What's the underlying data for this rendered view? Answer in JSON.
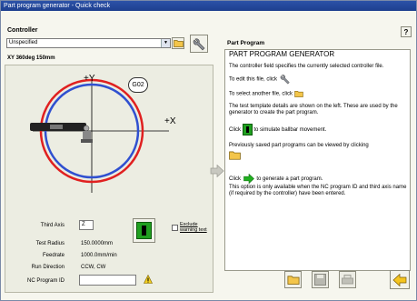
{
  "window": {
    "title": "Part program generator - Quick check"
  },
  "controller": {
    "heading": "Controller",
    "selected": "Unspecified"
  },
  "plot": {
    "heading": "XY 360deg 150mm",
    "plus_y": "+Y",
    "plus_x": "+X",
    "g02": "G02"
  },
  "settings": {
    "third_axis_label": "Third Axis",
    "third_axis_value": "Z",
    "test_radius_label": "Test Radius",
    "test_radius_value": "150.0000mm",
    "feedrate_label": "Feedrate",
    "feedrate_value": "1000.0mm/min",
    "run_direction_label": "Run Direction",
    "run_direction_value": "CCW, CW",
    "nc_program_id_label": "NC Program ID",
    "nc_program_id_value": "",
    "exclude_label_1": "Exclude",
    "exclude_label_2": "warning text"
  },
  "part_program": {
    "heading": "Part Program",
    "title": "PART PROGRAM GENERATOR",
    "p1": "The controller field specifies the currently selected controller file.",
    "p2": "To edit this file, click",
    "p3": "To select another file, click",
    "p4": "The test template details are shown on the left. These are used by the generator to create the part program.",
    "p5_a": "Click",
    "p5_b": "to simulate ballbar movement.",
    "p6": "Previously saved part programs can be viewed by clicking",
    "p7_a": "Click",
    "p7_b": "to generate a part program.",
    "p8": "This option is only available when the NC program ID and third axis name (if required by the controller) have been entered."
  },
  "help": {
    "label": "?"
  },
  "colors": {
    "titlebar": "#2c52a8",
    "circle_red": "#e02020",
    "circle_blue": "#3050d0",
    "go_green": "#20a020"
  }
}
